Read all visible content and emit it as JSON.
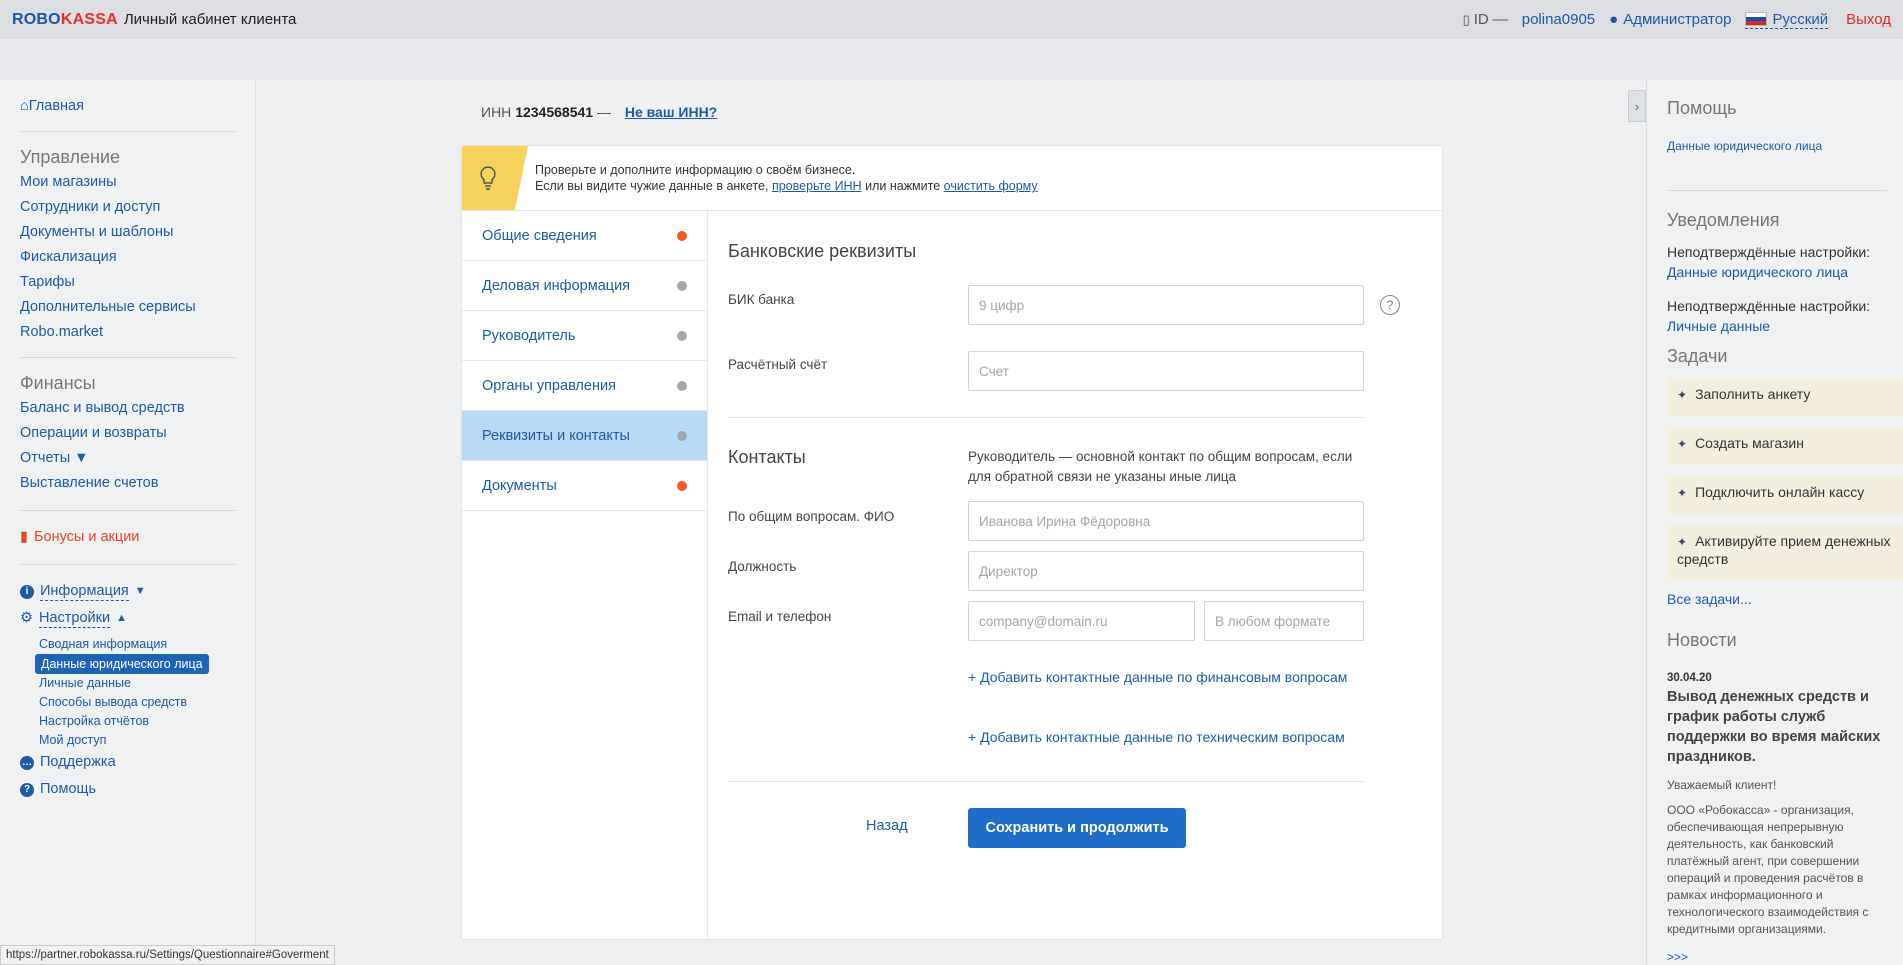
{
  "header": {
    "logo_robo": "ROBO",
    "logo_kassa": "KASSA",
    "title": "Личный кабинет клиента",
    "id_label": "ID",
    "dash": "—",
    "login": "polina0905",
    "role": "Администратор",
    "language": "Русский",
    "exit": "Выход"
  },
  "sidebar": {
    "home": "Главная",
    "management_title": "Управление",
    "management": [
      "Мои магазины",
      "Сотрудники и доступ",
      "Документы и шаблоны",
      "Фискализация",
      "Тарифы",
      "Дополнительные сервисы",
      "Robo.market"
    ],
    "finance_title": "Финансы",
    "finance": [
      "Баланс и вывод средств",
      "Операции и возвраты",
      "Отчеты ▼",
      "Выставление счетов"
    ],
    "bonus": "Бонусы и акции",
    "info": "Информация",
    "settings": "Настройки",
    "settings_items": [
      "Сводная информация",
      "Данные юридического лица",
      "Личные данные",
      "Способы вывода средств",
      "Настройка отчётов",
      "Мой доступ"
    ],
    "support": "Поддержка",
    "help": "Помощь"
  },
  "inn": {
    "label": "ИНН",
    "value": "1234568541",
    "dash": "—",
    "link": "Не ваш ИНН?"
  },
  "notice": {
    "line1": "Проверьте и дополните информацию о своём бизнесе.",
    "line2_before": "Если вы видите чужие данные в анкете,",
    "link1": "проверьте ИНН",
    "line2_mid": "или нажмите",
    "link2": "очистить форму"
  },
  "tabs": [
    {
      "label": "Общие сведения",
      "dot": "red"
    },
    {
      "label": "Деловая информация",
      "dot": "grey"
    },
    {
      "label": "Руководитель",
      "dot": "grey"
    },
    {
      "label": "Органы управления",
      "dot": "grey"
    },
    {
      "label": "Реквизиты и контакты",
      "dot": "grey",
      "active": true
    },
    {
      "label": "Документы",
      "dot": "red"
    }
  ],
  "form": {
    "bank_title": "Банковские реквизиты",
    "bik_label": "БИК банка",
    "bik_placeholder": "9 цифр",
    "account_label": "Расчётный счёт",
    "account_placeholder": "Счет",
    "contacts_title": "Контакты",
    "contacts_note": "Руководитель — основной контакт по общим вопросам, если для обратной связи не указаны иные лица",
    "fio_label": "По общим вопросам. ФИО",
    "fio_placeholder": "Иванова Ирина Фёдоровна",
    "position_label": "Должность",
    "position_placeholder": "Директор",
    "email_label": "Email и телефон",
    "email_placeholder": "company@domain.ru",
    "phone_placeholder": "В любом формате",
    "add_finance": "+ Добавить контактные данные по финансовым вопросам",
    "add_tech": "+ Добавить контактные данные по техническим вопросам",
    "back": "Назад",
    "save": "Сохранить и продолжить",
    "help_icon": "?"
  },
  "right": {
    "help_title": "Помощь",
    "help_link": "Данные юридического лица",
    "notif_title": "Уведомления",
    "notif1_text": "Неподтверждённые настройки:",
    "notif1_link": "Данные юридического лица",
    "notif2_text": "Неподтверждённые настройки:",
    "notif2_link": "Личные данные",
    "tasks_title": "Задачи",
    "tasks": [
      "Заполнить анкету",
      "Создать магазин",
      "Подключить онлайн кассу",
      "Активируйте прием денежных средств"
    ],
    "all_tasks": "Все задачи...",
    "news_title": "Новости",
    "news_date": "30.04.20",
    "news_headline": "Вывод денежных средств и график работы служб поддержки во время майских праздников.",
    "news_greeting": "Уважаемый клиент!",
    "news_body": "ООО «Робокасса» - организация, обеспечивающая непрерывную деятельность, как банковский платёжный агент, при совершении операций и проведения расчётов в рамках информационного и технологического взаимодействия с кредитными организациями.",
    "more": ">>>"
  },
  "status_url": "https://partner.robokassa.ru/Settings/Questionnaire#Goverment",
  "colors": {
    "brand_blue": "#1a57a7",
    "brand_red": "#e4312b",
    "accent": "#1e6ec8",
    "active_tab": "#b9d9f5"
  }
}
